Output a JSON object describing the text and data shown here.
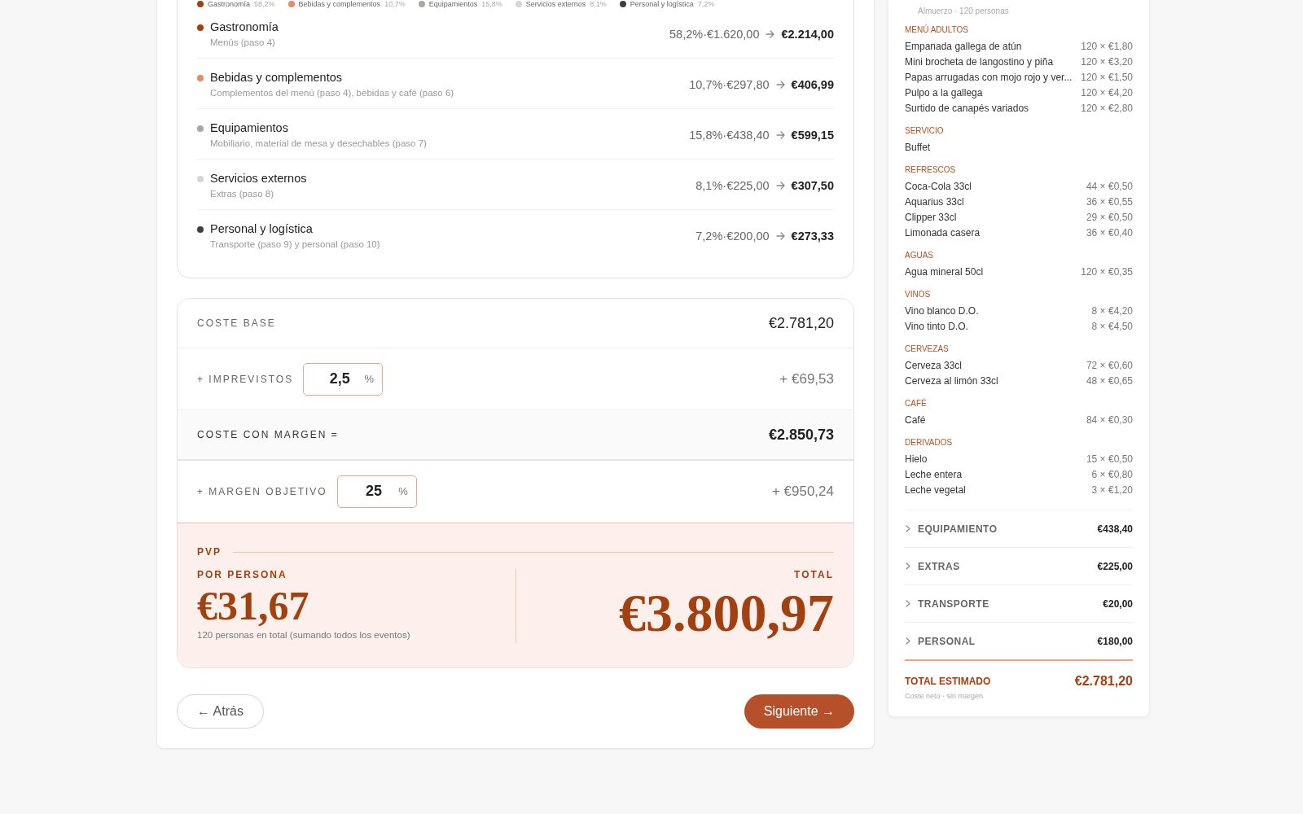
{
  "legend": [
    {
      "label": "Gastronomía",
      "pct": "58,2%",
      "color": "#a3400f"
    },
    {
      "label": "Bebidas y complementos",
      "pct": "10,7%",
      "color": "#e8896a"
    },
    {
      "label": "Equipamientos",
      "pct": "15,8%",
      "color": "#a9a6a3"
    },
    {
      "label": "Servicios externos",
      "pct": "8,1%",
      "color": "#d8d6d4"
    },
    {
      "label": "Personal y logística",
      "pct": "7,2%",
      "color": "#3e3d42"
    }
  ],
  "categories": [
    {
      "name": "Gastronomía",
      "detail": "Menús (paso 4)",
      "base": "58,2%·€1.620,00",
      "total": "€2.214,00",
      "color": "#a3400f"
    },
    {
      "name": "Bebidas y complementos",
      "detail": "Complementos del menú (paso 4), bebidas y café (paso 6)",
      "base": "10,7%·€297,80",
      "total": "€406,99",
      "color": "#e8896a"
    },
    {
      "name": "Equipamientos",
      "detail": "Mobiliario, material de mesa y desechables (paso 7)",
      "base": "15,8%·€438,40",
      "total": "€599,15",
      "color": "#a9a6a3"
    },
    {
      "name": "Servicios externos",
      "detail": "Extras (paso 8)",
      "base": "8,1%·€225,00",
      "total": "€307,50",
      "color": "#d8d6d4"
    },
    {
      "name": "Personal y logística",
      "detail": "Transporte (paso 9) y personal (paso 10)",
      "base": "7,2%·€200,00",
      "total": "€273,33",
      "color": "#3e3d42"
    }
  ],
  "costs": [
    {
      "kind": "base",
      "label": "COSTE BASE",
      "value": "€2.781,20"
    },
    {
      "kind": "input",
      "label": "+ IMPREVISTOS",
      "input": "2,5",
      "unit": "%",
      "value": "+ €69,53"
    },
    {
      "kind": "subtotal",
      "label": "COSTE CON MARGEN =",
      "value": "€2.850,73"
    },
    {
      "kind": "input",
      "label": "+ MARGEN OBJETIVO",
      "input": "25",
      "unit": "%",
      "value": "+ €950,24"
    }
  ],
  "pvp": {
    "label": "PVP",
    "per_person_label": "POR PERSONA",
    "per_person": "€31,67",
    "note": "120 personas en total (sumando todos los eventos)",
    "total_label": "TOTAL",
    "total": "€3.800,97"
  },
  "buttons": {
    "back": "← Atrás",
    "next": "Siguiente →"
  },
  "summary": {
    "subtitle": "Almuerzo · 120 personas",
    "groups": [
      {
        "heading": "MENÚ ADULTOS",
        "items": [
          {
            "name": "Empanada gallega de atún",
            "qty": "120 × €1,80"
          },
          {
            "name": "Mini brocheta de langostino y piña",
            "qty": "120 × €3,20"
          },
          {
            "name": "Papas arrugadas con mojo rojo y ver...",
            "qty": "120 × €1,50"
          },
          {
            "name": "Pulpo a la gallega",
            "qty": "120 × €4,20"
          },
          {
            "name": "Surtido de canapés variados",
            "qty": "120 × €2,80"
          }
        ]
      },
      {
        "heading": "SERVICIO",
        "items": [
          {
            "name": "Buffet"
          }
        ]
      },
      {
        "heading": "REFRESCOS",
        "items": [
          {
            "name": "Coca-Cola 33cl",
            "qty": "44 × €0,50"
          },
          {
            "name": "Aquarius 33cl",
            "qty": "36 × €0,55"
          },
          {
            "name": "Clipper 33cl",
            "qty": "29 × €0,50"
          },
          {
            "name": "Limonada casera",
            "qty": "36 × €0,40"
          }
        ]
      },
      {
        "heading": "AGUAS",
        "items": [
          {
            "name": "Agua mineral 50cl",
            "qty": "120 × €0,35"
          }
        ]
      },
      {
        "heading": "VINOS",
        "items": [
          {
            "name": "Vino blanco D.O.",
            "qty": "8 × €4,20"
          },
          {
            "name": "Vino tinto D.O.",
            "qty": "8 × €4,50"
          }
        ]
      },
      {
        "heading": "CERVEZAS",
        "items": [
          {
            "name": "Cerveza 33cl",
            "qty": "72 × €0,60"
          },
          {
            "name": "Cerveza al limón 33cl",
            "qty": "48 × €0,65"
          }
        ]
      },
      {
        "heading": "CAFÉ",
        "items": [
          {
            "name": "Café",
            "qty": "84 × €0,30"
          }
        ]
      },
      {
        "heading": "DERIVADOS",
        "items": [
          {
            "name": "Hielo",
            "qty": "15 × €0,50"
          },
          {
            "name": "Leche entera",
            "qty": "6 × €0,80"
          },
          {
            "name": "Leche vegetal",
            "qty": "3 × €1,20"
          }
        ]
      }
    ],
    "sections": [
      {
        "label": "EQUIPAMIENTO",
        "value": "€438,40",
        "expanded": false
      },
      {
        "label": "EXTRAS",
        "value": "€225,00",
        "expanded": false
      },
      {
        "label": "TRANSPORTE",
        "value": "€20,00",
        "expanded": false
      },
      {
        "label": "PERSONAL",
        "value": "€180,00",
        "expanded": false
      }
    ],
    "total": {
      "label": "TOTAL ESTIMADO",
      "value": "€2.781,20",
      "note": "Coste neto · sin margen"
    }
  }
}
